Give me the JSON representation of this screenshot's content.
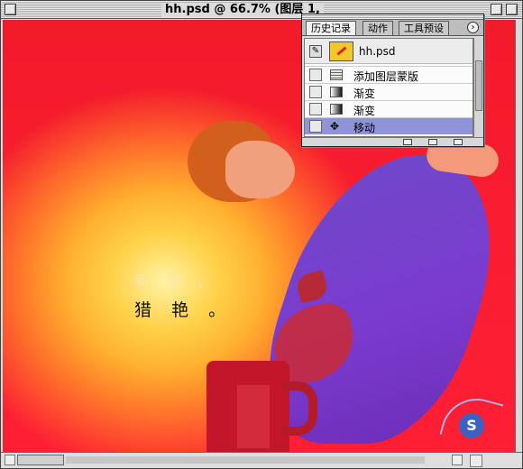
{
  "window": {
    "title": "hh.psd @ 66.7% (图层 1, "
  },
  "canvas_text": {
    "line1": "新 欢 。",
    "line2": "猎 艳 。"
  },
  "history_palette": {
    "tabs": [
      "历史记录",
      "动作",
      "工具预设"
    ],
    "menu_glyph": "›",
    "snapshot_label": "hh.psd",
    "items": [
      {
        "label": "添加图层蒙版",
        "icon": "layer-mask-icon"
      },
      {
        "label": "渐变",
        "icon": "gradient-icon"
      },
      {
        "label": "渐变",
        "icon": "gradient-icon"
      },
      {
        "label": "移动",
        "icon": "move-tool-icon"
      }
    ]
  },
  "accent_colors": {
    "canvas_red": "#f21b2a",
    "selected_row": "#8f93d7"
  }
}
